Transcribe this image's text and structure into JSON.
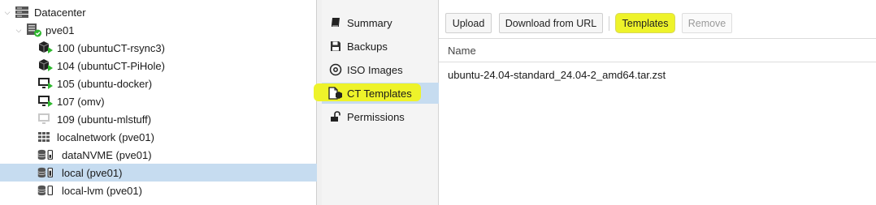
{
  "tree": {
    "items": [
      {
        "label": "Datacenter",
        "icon": "datacenter-icon"
      },
      {
        "label": "pve01",
        "icon": "node-online-icon"
      },
      {
        "label": "100 (ubuntuCT-rsync3)",
        "icon": "container-running-icon"
      },
      {
        "label": "104 (ubuntuCT-PiHole)",
        "icon": "container-running-icon"
      },
      {
        "label": "105 (ubuntu-docker)",
        "icon": "vm-running-icon"
      },
      {
        "label": "107 (omv)",
        "icon": "vm-running-icon"
      },
      {
        "label": "109 (ubuntu-mlstuff)",
        "icon": "vm-stopped-icon"
      },
      {
        "label": "localnetwork (pve01)",
        "icon": "network-grid-icon"
      },
      {
        "label": "dataNVME (pve01)",
        "icon": "storage-icon"
      },
      {
        "label": "local (pve01)",
        "icon": "storage-icon"
      },
      {
        "label": "local-lvm (pve01)",
        "icon": "storage-icon"
      }
    ],
    "selected": "local (pve01)"
  },
  "nav": {
    "items": [
      {
        "label": "Summary",
        "icon": "book-icon"
      },
      {
        "label": "Backups",
        "icon": "floppy-icon"
      },
      {
        "label": "ISO Images",
        "icon": "disc-icon"
      },
      {
        "label": "CT Templates",
        "icon": "template-icon"
      },
      {
        "label": "Permissions",
        "icon": "unlock-icon"
      }
    ],
    "active": "CT Templates"
  },
  "toolbar": {
    "upload": "Upload",
    "download_url": "Download from URL",
    "templates": "Templates",
    "remove": "Remove"
  },
  "table": {
    "columns": [
      "Name"
    ],
    "rows": [
      [
        "ubuntu-24.04-standard_24.04-2_amd64.tar.zst"
      ]
    ]
  },
  "colors": {
    "selection": "#c6dcf0",
    "highlight": "#eef32a",
    "running_green": "#2eb82e"
  }
}
